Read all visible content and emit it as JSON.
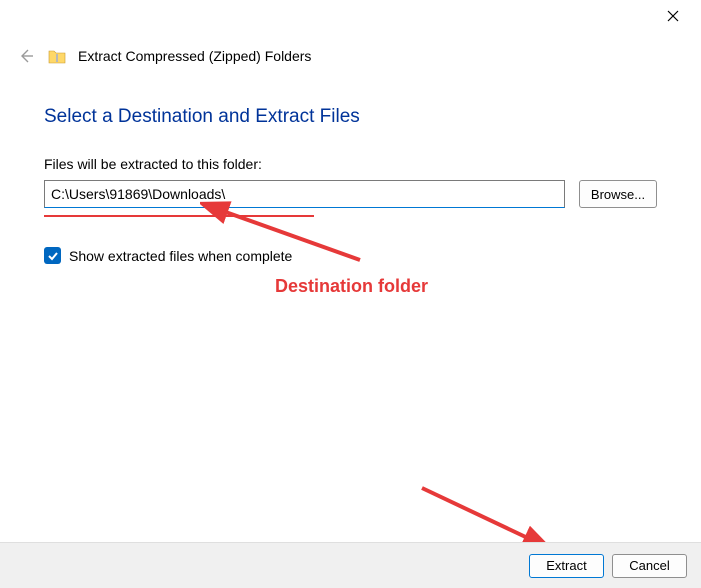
{
  "window": {
    "title": "Extract Compressed (Zipped) Folders"
  },
  "heading": "Select a Destination and Extract Files",
  "pathLabel": "Files will be extracted to this folder:",
  "pathValue": "C:\\Users\\91869\\Downloads\\",
  "browseLabel": "Browse...",
  "checkboxLabel": "Show extracted files when complete",
  "footer": {
    "extract": "Extract",
    "cancel": "Cancel"
  },
  "annotation": {
    "text": "Destination folder"
  }
}
